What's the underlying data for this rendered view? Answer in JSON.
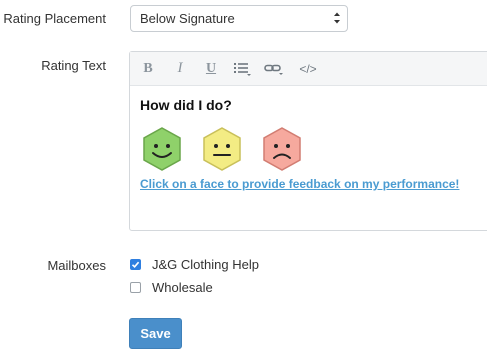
{
  "rating_placement": {
    "label": "Rating Placement",
    "selected_value": "Below Signature"
  },
  "rating_text": {
    "label": "Rating Text",
    "toolbar": {
      "bold_label": "B",
      "italic_label": "I",
      "underline_label": "U",
      "code_label": "</>"
    },
    "content": {
      "heading": "How did I do?",
      "faces": [
        {
          "icon": "happy-face-icon",
          "color": "#8fd16a"
        },
        {
          "icon": "neutral-face-icon",
          "color": "#f3ec84"
        },
        {
          "icon": "sad-face-icon",
          "color": "#f6a99e"
        }
      ],
      "link_text": "Click on a face to provide feedback on my performance!"
    }
  },
  "mailboxes": {
    "label": "Mailboxes",
    "items": [
      {
        "label": "J&G Clothing Help",
        "checked": true
      },
      {
        "label": "Wholesale",
        "checked": false
      }
    ]
  },
  "save_label": "Save",
  "colors": {
    "accent": "#4a8fcb",
    "link": "#4a9bd1",
    "checkbox_checked": "#2f7fe0"
  }
}
